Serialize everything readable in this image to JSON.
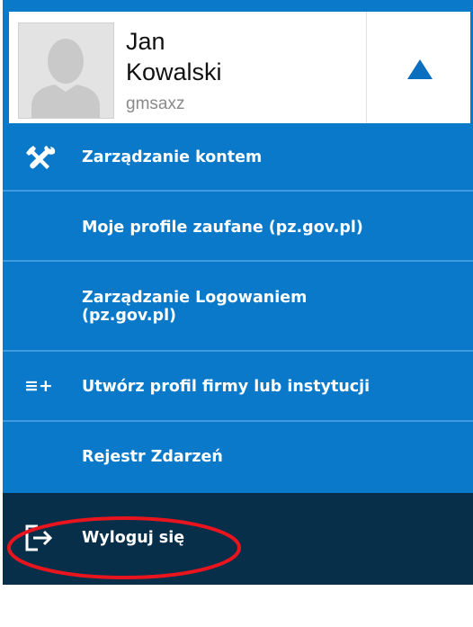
{
  "user": {
    "first_name": "Jan",
    "last_name": "Kowalski",
    "username": "gmsaxz"
  },
  "menu": {
    "items": [
      {
        "label": "Zarządzanie kontem",
        "icon": "tools-icon"
      },
      {
        "label": "Moje profile zaufane (pz.gov.pl)"
      },
      {
        "label": "Zarządzanie Logowaniem\n(pz.gov.pl)"
      },
      {
        "label": "Utwórz profil firmy lub instytucji",
        "icon": "list-add-icon",
        "icon_text": "≡+"
      },
      {
        "label": "Rejestr Zdarzeń"
      }
    ],
    "logout": {
      "label": "Wyloguj się",
      "icon": "logout-icon"
    }
  },
  "colors": {
    "menu_background": "#0a79c9",
    "menu_divider": "#3e9be0",
    "logout_background": "#072f4a",
    "highlight": "#e8141e"
  }
}
